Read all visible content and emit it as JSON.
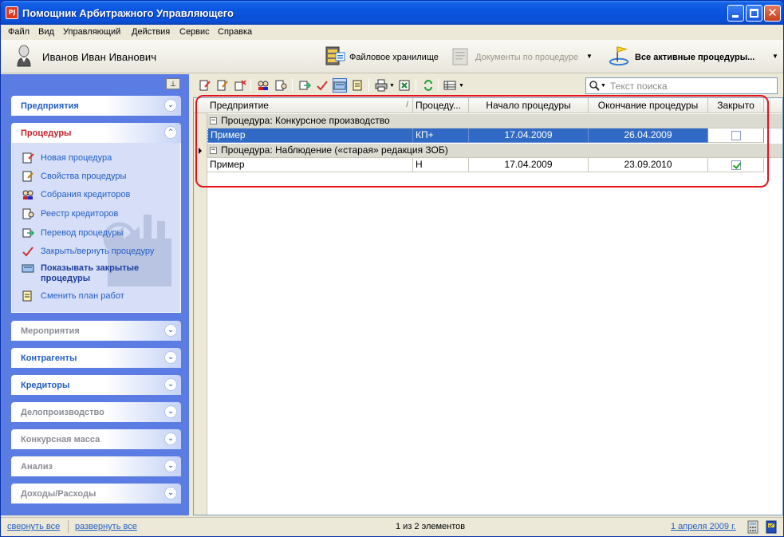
{
  "window": {
    "title": "Помощник Арбитражного Управляющего",
    "icon_text": "PJ"
  },
  "menu": [
    "Файл",
    "Вид",
    "Управляющий",
    "Действия",
    "Сервис",
    "Справка"
  ],
  "userbar": {
    "user_name": "Иванов Иван Иванович",
    "file_storage_label": "Файловое хранилище",
    "documents_label": "Документы по процедуре",
    "active_procedures_label": "Все активные процедуры..."
  },
  "sidebar": {
    "pin_glyph": "⊥",
    "groups": [
      {
        "label": "Предприятия",
        "state": "normal"
      },
      {
        "label": "Процедуры",
        "state": "active"
      },
      {
        "label": "Мероприятия",
        "state": "disabled"
      },
      {
        "label": "Контрагенты",
        "state": "normal"
      },
      {
        "label": "Кредиторы",
        "state": "normal"
      },
      {
        "label": "Делопроизводство",
        "state": "disabled"
      },
      {
        "label": "Конкурсная масса",
        "state": "disabled"
      },
      {
        "label": "Анализ",
        "state": "disabled"
      },
      {
        "label": "Доходы/Расходы",
        "state": "disabled"
      }
    ],
    "tasks": [
      {
        "label": "Новая процедура",
        "icon": "new-procedure-icon"
      },
      {
        "label": "Свойства процедуры",
        "icon": "procedure-properties-icon"
      },
      {
        "label": "Собрания кредиторов",
        "icon": "creditors-meeting-icon"
      },
      {
        "label": "Реестр кредиторов",
        "icon": "creditors-registry-icon"
      },
      {
        "label": "Перевод процедуры",
        "icon": "transfer-procedure-icon"
      },
      {
        "label": "Закрыть/вернуть процедуру",
        "icon": "close-procedure-icon"
      },
      {
        "label": "Показывать закрытые",
        "label2": "процедуры",
        "icon": "show-closed-icon"
      },
      {
        "label": "Сменить план работ",
        "icon": "change-plan-icon"
      }
    ]
  },
  "search": {
    "placeholder": "Текст поиска"
  },
  "grid": {
    "columns": [
      "Предприятие",
      "Процеду...",
      "Начало процедуры",
      "Окончание процедуры",
      "Закрыто"
    ],
    "sort_glyph": "/",
    "groups": [
      {
        "label": "Процедура: Конкурсное производство",
        "rows": [
          {
            "enterprise": "Пример",
            "procedure": "КП+",
            "start": "17.04.2009",
            "end": "26.04.2009",
            "closed": false,
            "selected": true
          }
        ]
      },
      {
        "label": "Процедура: Наблюдение («старая» редакция ЗОБ)",
        "rows": [
          {
            "enterprise": "Пример",
            "procedure": "Н",
            "start": "17.04.2009",
            "end": "23.09.2010",
            "closed": true,
            "selected": false
          }
        ]
      }
    ]
  },
  "status": {
    "collapse_all": "свернуть все",
    "expand_all": "развернуть все",
    "record_count": "1 из 2 элементов",
    "date": "1 апреля 2009 г."
  },
  "colors": {
    "accent": "#215dc6",
    "selection": "#316ac5",
    "highlight": "#e6131d",
    "sidebar": "#5b7de3"
  }
}
